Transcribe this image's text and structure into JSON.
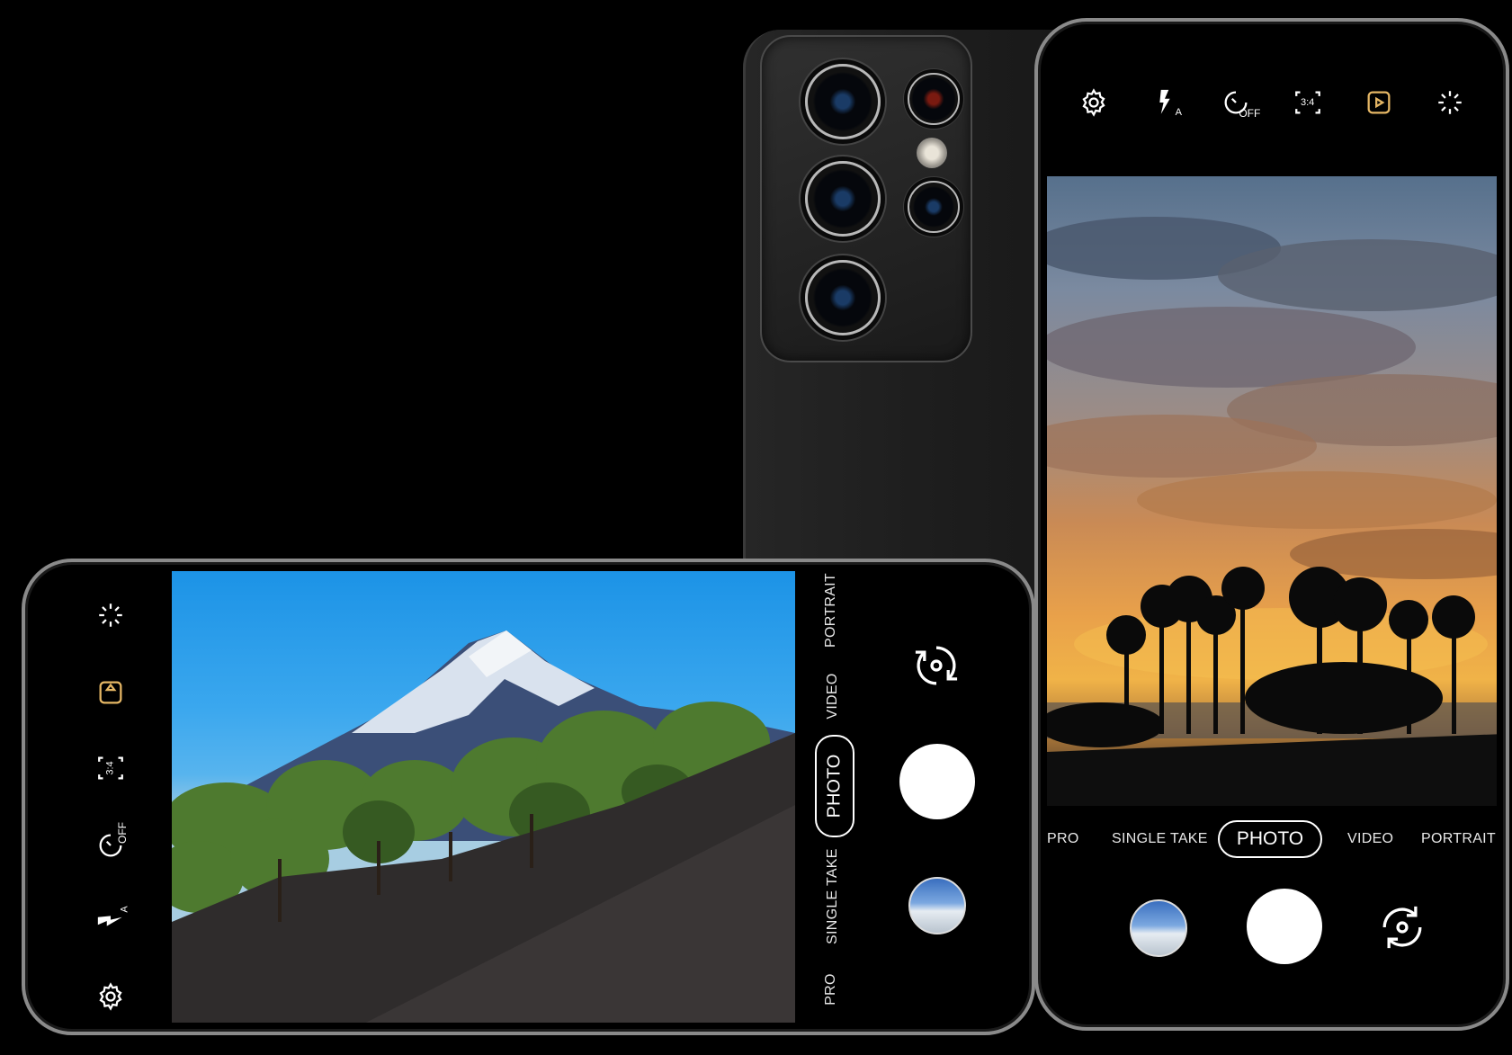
{
  "right_phone": {
    "top_icons": [
      "gear-icon",
      "flash-auto-icon",
      "timer-off-icon",
      "aspect-ratio-icon",
      "motion-photo-icon",
      "effects-icon"
    ],
    "aspect_label": "3:4",
    "timer_label": "OFF",
    "flash_label": "A",
    "modes": [
      "PRO",
      "SINGLE TAKE",
      "PHOTO",
      "VIDEO",
      "PORTRAIT"
    ],
    "active_mode": "PHOTO"
  },
  "left_phone": {
    "side_icons": [
      "effects-icon",
      "motion-photo-icon",
      "aspect-ratio-icon",
      "timer-off-icon",
      "flash-auto-icon",
      "gear-icon"
    ],
    "aspect_label": "3:4",
    "timer_label": "OFF",
    "flash_label": "A",
    "modes": [
      "PORTRAIT",
      "VIDEO",
      "PHOTO",
      "SINGLE TAKE",
      "PRO"
    ],
    "active_mode": "PHOTO"
  },
  "colors": {
    "accent_motion": "#e6b765",
    "ui_white": "#ffffff"
  }
}
